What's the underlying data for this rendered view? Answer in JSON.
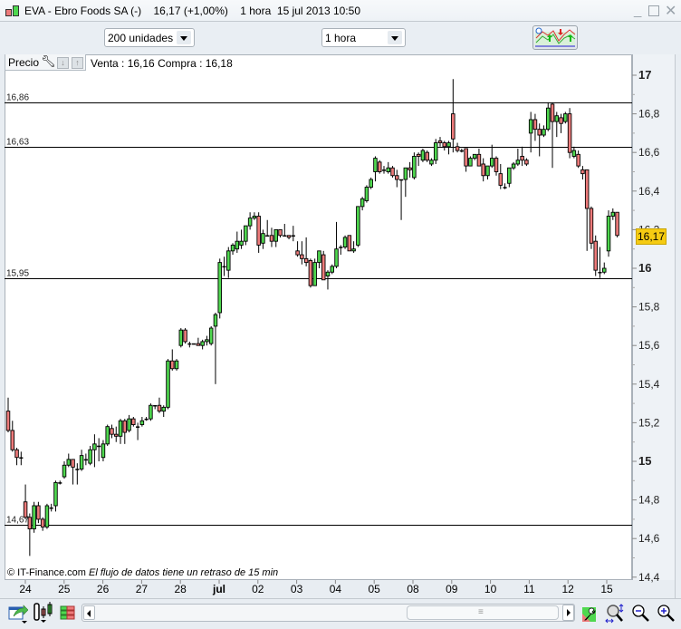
{
  "window": {
    "title": "EVA - Ebro Foods SA (-)    16,17 (+1,00%)    1 hora  15 jul 2013 10:50",
    "minimize_icon": "minimize-icon",
    "maximize_icon": "maximize-icon",
    "close_icon": "close-icon"
  },
  "toolbar": {
    "units_select": "200 unidades",
    "period_select": "1 hora",
    "indicators_icon": "indicators-icon"
  },
  "panel": {
    "tab_label": "Precio",
    "quote": "Venta : 16,16 Compra : 16,18"
  },
  "footer": {
    "copyright": "© IT-Finance.com",
    "delay_note": "El flujo de datos tiene un retraso de 15 min"
  },
  "colors": {
    "up": "#4fd84f",
    "down": "#ee7b7b",
    "badge": "#f5cb12"
  },
  "chart_data": {
    "type": "candlestick",
    "symbol": "EVA",
    "interval": "1 hora",
    "current_price": "16,17",
    "ylim": [
      14.4,
      17.0
    ],
    "y_ticks": [
      {
        "value": 17.0,
        "label": "17",
        "major": true
      },
      {
        "value": 16.8,
        "label": "16,8"
      },
      {
        "value": 16.6,
        "label": "16,6"
      },
      {
        "value": 16.4,
        "label": "16,4"
      },
      {
        "value": 16.2,
        "label": "16,2"
      },
      {
        "value": 16.0,
        "label": "16",
        "major": true
      },
      {
        "value": 15.8,
        "label": "15,8"
      },
      {
        "value": 15.6,
        "label": "15,6"
      },
      {
        "value": 15.4,
        "label": "15,4"
      },
      {
        "value": 15.2,
        "label": "15,2"
      },
      {
        "value": 15.0,
        "label": "15",
        "major": true
      },
      {
        "value": 14.8,
        "label": "14,8"
      },
      {
        "value": 14.6,
        "label": "14,6"
      },
      {
        "value": 14.4,
        "label": "14,4"
      }
    ],
    "x_labels": [
      "24",
      "25",
      "26",
      "27",
      "28",
      "jul",
      "02",
      "03",
      "04",
      "05",
      "08",
      "09",
      "10",
      "11",
      "12",
      "15"
    ],
    "levels": [
      {
        "value": 16.86,
        "label": "16,86"
      },
      {
        "value": 16.63,
        "label": "16,63"
      },
      {
        "value": 15.95,
        "label": "15,95"
      },
      {
        "value": 14.67,
        "label": "14,67"
      }
    ],
    "ohlc": [
      [
        15.26,
        15.33,
        15.15,
        15.16
      ],
      [
        15.16,
        15.21,
        15.05,
        15.06
      ],
      [
        15.06,
        15.07,
        14.98,
        15.02
      ],
      [
        15.02,
        15.05,
        14.98,
        15.02
      ],
      [
        14.79,
        14.88,
        14.7,
        14.71
      ],
      [
        14.71,
        14.73,
        14.51,
        14.65
      ],
      [
        14.65,
        14.79,
        14.63,
        14.77
      ],
      [
        14.77,
        14.79,
        14.68,
        14.7
      ],
      [
        14.7,
        14.71,
        14.64,
        14.66
      ],
      [
        14.66,
        14.78,
        14.65,
        14.77
      ],
      [
        14.76,
        14.78,
        14.74,
        14.76
      ],
      [
        14.77,
        14.9,
        14.74,
        14.89
      ],
      [
        14.89,
        14.9,
        14.88,
        14.89
      ],
      [
        14.92,
        15.0,
        14.91,
        14.98
      ],
      [
        14.98,
        15.04,
        14.97,
        15.01
      ],
      [
        15.01,
        15.01,
        14.88,
        14.97
      ],
      [
        14.96,
        14.99,
        14.88,
        14.96
      ],
      [
        14.96,
        15.06,
        14.95,
        15.03
      ],
      [
        15.01,
        15.04,
        14.98,
        15.01
      ],
      [
        14.99,
        15.08,
        14.98,
        15.06
      ],
      [
        15.06,
        15.14,
        14.97,
        15.09
      ],
      [
        15.08,
        15.12,
        15.0,
        15.08
      ],
      [
        15.02,
        15.11,
        15.0,
        15.09
      ],
      [
        15.09,
        15.19,
        15.08,
        15.18
      ],
      [
        15.17,
        15.19,
        15.12,
        15.14
      ],
      [
        15.14,
        15.18,
        15.1,
        15.13
      ],
      [
        15.13,
        15.22,
        15.09,
        15.21
      ],
      [
        15.21,
        15.22,
        15.09,
        15.15
      ],
      [
        15.16,
        15.24,
        15.15,
        15.22
      ],
      [
        15.22,
        15.23,
        15.18,
        15.19
      ],
      [
        15.18,
        15.2,
        15.11,
        15.18
      ],
      [
        15.19,
        15.23,
        15.18,
        15.21
      ],
      [
        15.22,
        15.23,
        15.21,
        15.22
      ],
      [
        15.22,
        15.3,
        15.21,
        15.29
      ],
      [
        15.29,
        15.29,
        15.27,
        15.29
      ],
      [
        15.29,
        15.33,
        15.25,
        15.26
      ],
      [
        15.26,
        15.29,
        15.23,
        15.28
      ],
      [
        15.28,
        15.53,
        15.27,
        15.52
      ],
      [
        15.52,
        15.58,
        15.47,
        15.48
      ],
      [
        15.48,
        15.53,
        15.47,
        15.52
      ],
      [
        15.6,
        15.69,
        15.59,
        15.68
      ],
      [
        15.68,
        15.69,
        15.61,
        15.62
      ],
      [
        15.61,
        15.62,
        15.59,
        15.61
      ],
      [
        15.61,
        15.61,
        15.61,
        15.61
      ],
      [
        15.61,
        15.64,
        15.6,
        15.6
      ],
      [
        15.6,
        15.63,
        15.58,
        15.62
      ],
      [
        15.62,
        15.65,
        15.6,
        15.63
      ],
      [
        15.61,
        15.7,
        15.6,
        15.69
      ],
      [
        15.7,
        15.77,
        15.4,
        15.76
      ],
      [
        15.77,
        16.05,
        15.74,
        16.03
      ],
      [
        16.01,
        16.06,
        15.96,
        16.01
      ],
      [
        15.99,
        16.11,
        15.95,
        16.09
      ],
      [
        16.09,
        16.13,
        16.07,
        16.12
      ],
      [
        16.1,
        16.19,
        16.08,
        16.14
      ],
      [
        16.12,
        16.2,
        16.1,
        16.14
      ],
      [
        16.14,
        16.22,
        16.12,
        16.22
      ],
      [
        16.22,
        16.29,
        16.2,
        16.26
      ],
      [
        16.26,
        16.29,
        16.25,
        16.27
      ],
      [
        16.27,
        16.29,
        16.08,
        16.12
      ],
      [
        16.13,
        16.2,
        16.1,
        16.18
      ],
      [
        16.17,
        16.25,
        16.17,
        16.17
      ],
      [
        16.17,
        16.21,
        16.11,
        16.14
      ],
      [
        16.14,
        16.2,
        16.11,
        16.2
      ],
      [
        16.2,
        16.2,
        16.16,
        16.17
      ],
      [
        16.17,
        16.23,
        16.17,
        16.17
      ],
      [
        16.17,
        16.17,
        16.15,
        16.16
      ],
      [
        16.17,
        16.22,
        16.14,
        16.17
      ],
      [
        16.09,
        16.14,
        16.06,
        16.07
      ],
      [
        16.07,
        16.14,
        16.02,
        16.05
      ],
      [
        16.05,
        16.16,
        16.01,
        16.03
      ],
      [
        16.04,
        16.05,
        15.9,
        15.91
      ],
      [
        15.91,
        16.05,
        15.91,
        16.03
      ],
      [
        16.03,
        16.09,
        16.0,
        16.09
      ],
      [
        16.07,
        16.09,
        15.94,
        15.94
      ],
      [
        15.96,
        15.99,
        15.89,
        15.98
      ],
      [
        15.98,
        16.02,
        15.97,
        16.01
      ],
      [
        16.01,
        16.24,
        16.0,
        16.1
      ],
      [
        16.11,
        16.12,
        16.07,
        16.11
      ],
      [
        16.11,
        16.17,
        16.1,
        16.16
      ],
      [
        16.17,
        16.17,
        16.09,
        16.09
      ],
      [
        16.09,
        16.14,
        16.08,
        16.1
      ],
      [
        16.12,
        16.32,
        16.11,
        16.32
      ],
      [
        16.32,
        16.37,
        16.3,
        16.36
      ],
      [
        16.35,
        16.43,
        16.34,
        16.42
      ],
      [
        16.42,
        16.47,
        16.41,
        16.46
      ],
      [
        16.5,
        16.58,
        16.45,
        16.57
      ],
      [
        16.55,
        16.56,
        16.49,
        16.5
      ],
      [
        16.51,
        16.53,
        16.49,
        16.51
      ],
      [
        16.5,
        16.55,
        16.49,
        16.52
      ],
      [
        16.52,
        16.53,
        16.47,
        16.48
      ],
      [
        16.48,
        16.51,
        16.42,
        16.46
      ],
      [
        16.46,
        16.46,
        16.25,
        16.46
      ],
      [
        16.46,
        16.52,
        16.37,
        16.52
      ],
      [
        16.52,
        16.55,
        16.47,
        16.51
      ],
      [
        16.47,
        16.6,
        16.46,
        16.58
      ],
      [
        16.59,
        16.6,
        16.53,
        16.58
      ],
      [
        16.56,
        16.62,
        16.55,
        16.61
      ],
      [
        16.6,
        16.61,
        16.55,
        16.56
      ],
      [
        16.54,
        16.57,
        16.53,
        16.56
      ],
      [
        16.56,
        16.67,
        16.54,
        16.65
      ],
      [
        16.66,
        16.68,
        16.63,
        16.65
      ],
      [
        16.65,
        16.66,
        16.61,
        16.63
      ],
      [
        16.63,
        16.66,
        16.59,
        16.65
      ],
      [
        16.8,
        16.98,
        16.6,
        16.67
      ],
      [
        16.63,
        16.65,
        16.6,
        16.61
      ],
      [
        16.61,
        16.62,
        16.6,
        16.61
      ],
      [
        16.62,
        16.62,
        16.5,
        16.53
      ],
      [
        16.53,
        16.58,
        16.53,
        16.57
      ],
      [
        16.57,
        16.59,
        16.56,
        16.59
      ],
      [
        16.59,
        16.62,
        16.53,
        16.53
      ],
      [
        16.54,
        16.57,
        16.45,
        16.48
      ],
      [
        16.48,
        16.53,
        16.46,
        16.53
      ],
      [
        16.53,
        16.64,
        16.52,
        16.57
      ],
      [
        16.57,
        16.58,
        16.48,
        16.5
      ],
      [
        16.49,
        16.54,
        16.41,
        16.43
      ],
      [
        16.42,
        16.44,
        16.41,
        16.42
      ],
      [
        16.44,
        16.52,
        16.42,
        16.52
      ],
      [
        16.52,
        16.55,
        16.51,
        16.54
      ],
      [
        16.54,
        16.62,
        16.53,
        16.56
      ],
      [
        16.58,
        16.63,
        16.53,
        16.56
      ],
      [
        16.56,
        16.57,
        16.53,
        16.54
      ],
      [
        16.7,
        16.81,
        16.6,
        16.77
      ],
      [
        16.77,
        16.8,
        16.66,
        16.72
      ],
      [
        16.72,
        16.75,
        16.58,
        16.69
      ],
      [
        16.69,
        16.74,
        16.68,
        16.72
      ],
      [
        16.72,
        16.86,
        16.71,
        16.83
      ],
      [
        16.85,
        16.86,
        16.52,
        16.76
      ],
      [
        16.76,
        16.81,
        16.68,
        16.79
      ],
      [
        16.78,
        16.8,
        16.7,
        16.75
      ],
      [
        16.76,
        16.81,
        16.75,
        16.8
      ],
      [
        16.8,
        16.83,
        16.57,
        16.6
      ],
      [
        16.58,
        16.63,
        16.57,
        16.61
      ],
      [
        16.59,
        16.61,
        16.52,
        16.53
      ],
      [
        16.51,
        16.53,
        16.46,
        16.49
      ],
      [
        16.51,
        16.51,
        16.09,
        16.31
      ],
      [
        16.31,
        16.32,
        16.1,
        16.13
      ],
      [
        16.14,
        16.17,
        15.96,
        15.99
      ],
      [
        15.98,
        16.11,
        15.95,
        15.98
      ],
      [
        15.98,
        16.03,
        15.97,
        16.0
      ],
      [
        16.09,
        16.3,
        16.06,
        16.27
      ],
      [
        16.27,
        16.31,
        16.25,
        16.29
      ],
      [
        16.29,
        16.29,
        16.16,
        16.17
      ]
    ]
  },
  "bottom_toolbar": {
    "left_icons": [
      "chart-export-icon",
      "chart-type-icon",
      "compare-icon"
    ],
    "right_icons": [
      "settings-icon",
      "zoom-fit-icon",
      "zoom-out-icon",
      "zoom-in-icon"
    ]
  }
}
